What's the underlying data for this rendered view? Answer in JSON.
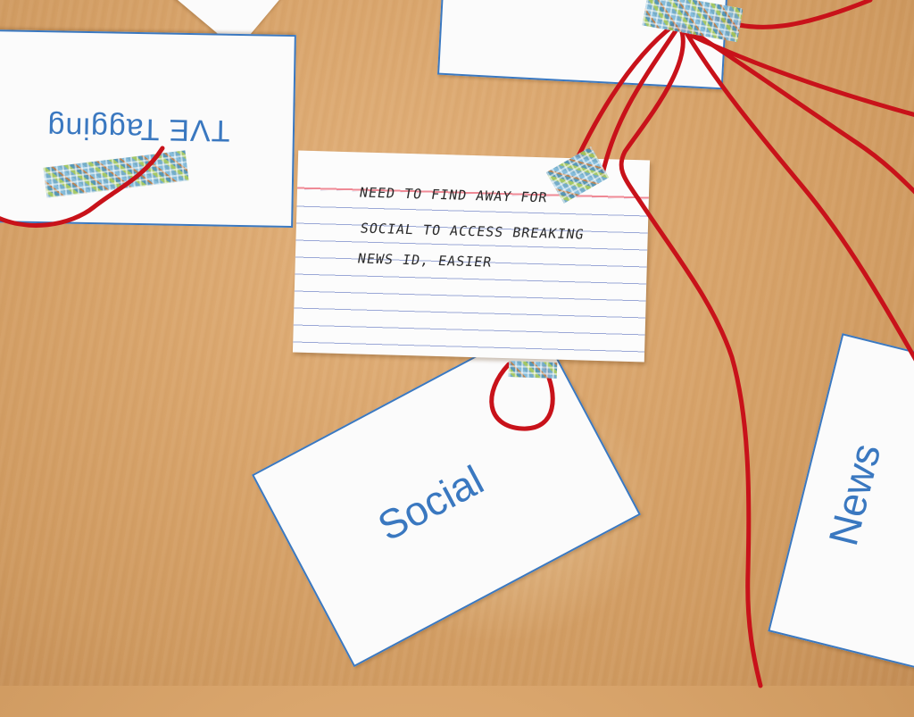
{
  "cards": {
    "tve": {
      "label": "TVE Tagging"
    },
    "social": {
      "label": "Social"
    },
    "news": {
      "label": "News"
    }
  },
  "index_card": {
    "lines": [
      "NEED TO FIND AWAY FOR",
      "SOCIAL TO ACCESS BREAKING",
      "NEWS ID, EASIER"
    ]
  },
  "colors": {
    "card_text": "#3a78c0",
    "yarn": "#c8121a",
    "table": "#d9a56c"
  }
}
